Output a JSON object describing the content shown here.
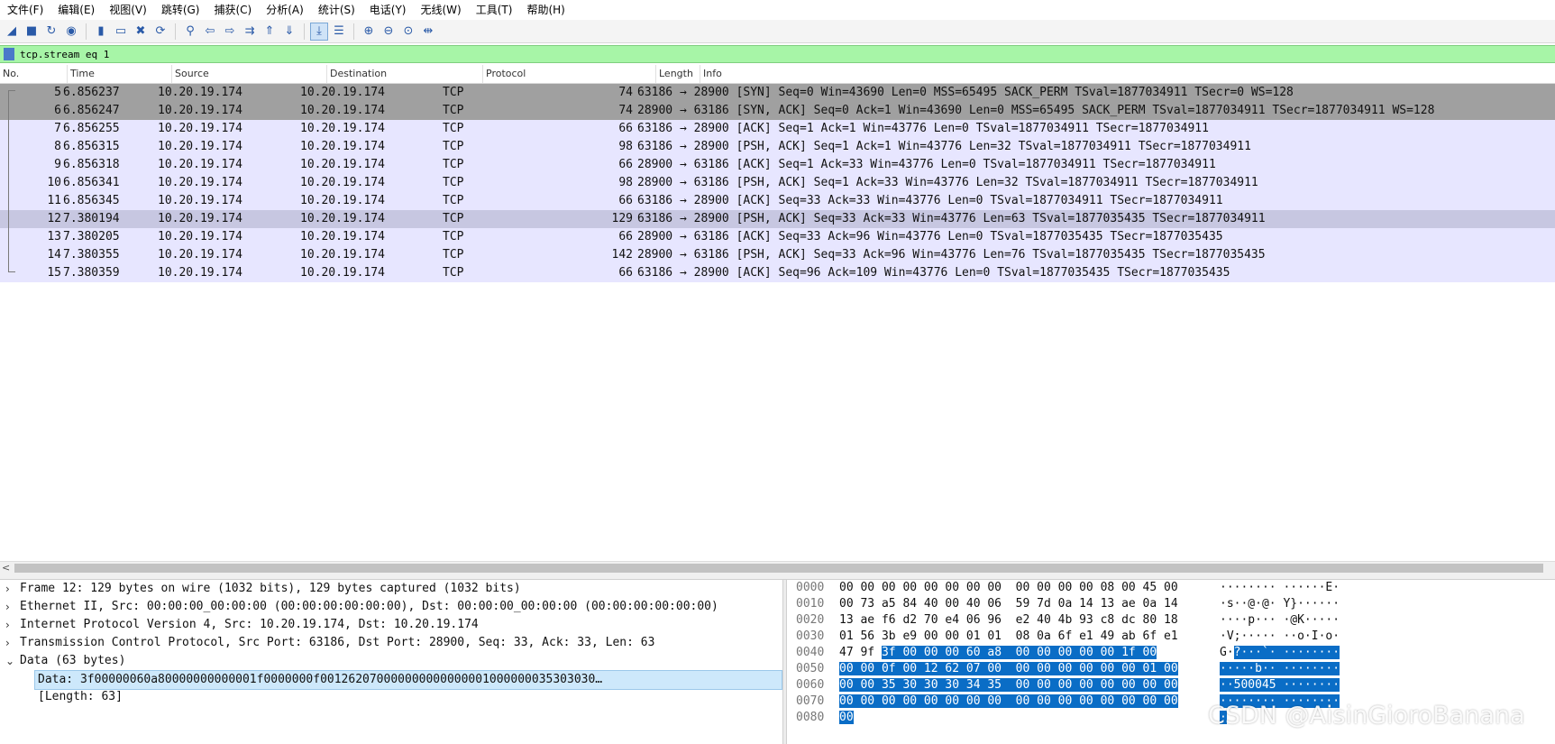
{
  "menu": [
    "文件(F)",
    "编辑(E)",
    "视图(V)",
    "跳转(G)",
    "捕获(C)",
    "分析(A)",
    "统计(S)",
    "电话(Y)",
    "无线(W)",
    "工具(T)",
    "帮助(H)"
  ],
  "toolbar": {
    "icons": [
      "shark-fin-start-icon",
      "stop-square-icon",
      "restart-fin-icon",
      "capture-options-icon",
      "open-folder-icon",
      "save-file-icon",
      "close-file-icon",
      "reload-icon",
      "find-packet-icon",
      "go-back-icon",
      "go-forward-icon",
      "go-to-packet-icon",
      "go-first-icon",
      "go-last-icon",
      "autoscroll-icon",
      "colorize-icon",
      "zoom-in-icon",
      "zoom-out-icon",
      "zoom-normal-icon",
      "resize-columns-icon"
    ],
    "glyphs": [
      "◢",
      "■",
      "↻",
      "◉",
      "▮",
      "▭",
      "✖",
      "⟳",
      "⚲",
      "⇦",
      "⇨",
      "⇉",
      "⇑",
      "⇓",
      "⤓",
      "☰",
      "⊕",
      "⊖",
      "⊙",
      "⇹"
    ]
  },
  "filter": {
    "text": "tcp.stream eq 1"
  },
  "packet_list": {
    "headers": [
      "No.",
      "Time",
      "Source",
      "Destination",
      "Protocol",
      "Length",
      "Info"
    ],
    "rows": [
      {
        "no": "5",
        "time": "6.856237",
        "src": "10.20.19.174",
        "dst": "10.20.19.174",
        "proto": "TCP",
        "len": "74",
        "info": "63186 → 28900 [SYN] Seq=0 Win=43690 Len=0 MSS=65495 SACK_PERM TSval=1877034911 TSecr=0 WS=128",
        "style": "syn"
      },
      {
        "no": "6",
        "time": "6.856247",
        "src": "10.20.19.174",
        "dst": "10.20.19.174",
        "proto": "TCP",
        "len": "74",
        "info": "28900 → 63186 [SYN, ACK] Seq=0 Ack=1 Win=43690 Len=0 MSS=65495 SACK_PERM TSval=1877034911 TSecr=1877034911 WS=128",
        "style": "syn"
      },
      {
        "no": "7",
        "time": "6.856255",
        "src": "10.20.19.174",
        "dst": "10.20.19.174",
        "proto": "TCP",
        "len": "66",
        "info": "63186 → 28900 [ACK] Seq=1 Ack=1 Win=43776 Len=0 TSval=1877034911 TSecr=1877034911",
        "style": "norm"
      },
      {
        "no": "8",
        "time": "6.856315",
        "src": "10.20.19.174",
        "dst": "10.20.19.174",
        "proto": "TCP",
        "len": "98",
        "info": "63186 → 28900 [PSH, ACK] Seq=1 Ack=1 Win=43776 Len=32 TSval=1877034911 TSecr=1877034911",
        "style": "norm"
      },
      {
        "no": "9",
        "time": "6.856318",
        "src": "10.20.19.174",
        "dst": "10.20.19.174",
        "proto": "TCP",
        "len": "66",
        "info": "28900 → 63186 [ACK] Seq=1 Ack=33 Win=43776 Len=0 TSval=1877034911 TSecr=1877034911",
        "style": "norm"
      },
      {
        "no": "10",
        "time": "6.856341",
        "src": "10.20.19.174",
        "dst": "10.20.19.174",
        "proto": "TCP",
        "len": "98",
        "info": "28900 → 63186 [PSH, ACK] Seq=1 Ack=33 Win=43776 Len=32 TSval=1877034911 TSecr=1877034911",
        "style": "norm"
      },
      {
        "no": "11",
        "time": "6.856345",
        "src": "10.20.19.174",
        "dst": "10.20.19.174",
        "proto": "TCP",
        "len": "66",
        "info": "63186 → 28900 [ACK] Seq=33 Ack=33 Win=43776 Len=0 TSval=1877034911 TSecr=1877034911",
        "style": "norm"
      },
      {
        "no": "12",
        "time": "7.380194",
        "src": "10.20.19.174",
        "dst": "10.20.19.174",
        "proto": "TCP",
        "len": "129",
        "info": "63186 → 28900 [PSH, ACK] Seq=33 Ack=33 Win=43776 Len=63 TSval=1877035435 TSecr=1877034911",
        "style": "sel"
      },
      {
        "no": "13",
        "time": "7.380205",
        "src": "10.20.19.174",
        "dst": "10.20.19.174",
        "proto": "TCP",
        "len": "66",
        "info": "28900 → 63186 [ACK] Seq=33 Ack=96 Win=43776 Len=0 TSval=1877035435 TSecr=1877035435",
        "style": "norm"
      },
      {
        "no": "14",
        "time": "7.380355",
        "src": "10.20.19.174",
        "dst": "10.20.19.174",
        "proto": "TCP",
        "len": "142",
        "info": "28900 → 63186 [PSH, ACK] Seq=33 Ack=96 Win=43776 Len=76 TSval=1877035435 TSecr=1877035435",
        "style": "norm"
      },
      {
        "no": "15",
        "time": "7.380359",
        "src": "10.20.19.174",
        "dst": "10.20.19.174",
        "proto": "TCP",
        "len": "66",
        "info": "63186 → 28900 [ACK] Seq=96 Ack=109 Win=43776 Len=0 TSval=1877035435 TSecr=1877035435",
        "style": "norm"
      }
    ]
  },
  "details": [
    {
      "arrow": "›",
      "text": "Frame 12: 129 bytes on wire (1032 bits), 129 bytes captured (1032 bits)",
      "kind": "top"
    },
    {
      "arrow": "›",
      "text": "Ethernet II, Src: 00:00:00_00:00:00 (00:00:00:00:00:00), Dst: 00:00:00_00:00:00 (00:00:00:00:00:00)",
      "kind": "top"
    },
    {
      "arrow": "›",
      "text": "Internet Protocol Version 4, Src: 10.20.19.174, Dst: 10.20.19.174",
      "kind": "top"
    },
    {
      "arrow": "›",
      "text": "Transmission Control Protocol, Src Port: 63186, Dst Port: 28900, Seq: 33, Ack: 33, Len: 63",
      "kind": "top"
    },
    {
      "arrow": "⌄",
      "text": "Data (63 bytes)",
      "kind": "top"
    },
    {
      "arrow": "",
      "text": "Data: 3f00000060a80000000000001f0000000f001262070000000000000001000000035303030…",
      "kind": "hl"
    },
    {
      "arrow": "",
      "text": "[Length: 63]",
      "kind": "sub"
    }
  ],
  "hex": [
    {
      "off": "0000",
      "pre": "00 00 00 00 00 00 00 00  00 00 00 00 08 00 45 00",
      "sel": "",
      "apre": "········ ······E·",
      "asel": ""
    },
    {
      "off": "0010",
      "pre": "00 73 a5 84 40 00 40 06  59 7d 0a 14 13 ae 0a 14",
      "sel": "",
      "apre": "·s··@·@· Y}······",
      "asel": ""
    },
    {
      "off": "0020",
      "pre": "13 ae f6 d2 70 e4 06 96  e2 40 4b 93 c8 dc 80 18",
      "sel": "",
      "apre": "····p··· ·@K·····",
      "asel": ""
    },
    {
      "off": "0030",
      "pre": "01 56 3b e9 00 00 01 01  08 0a 6f e1 49 ab 6f e1",
      "sel": "",
      "apre": "·V;····· ··o·I·o·",
      "asel": ""
    },
    {
      "off": "0040",
      "pre": "47 9f ",
      "sel": "3f 00 00 00 60 a8  00 00 00 00 00 1f 00",
      "apre": "G·",
      "asel": "?···`· ········"
    },
    {
      "off": "0050",
      "pre": "",
      "sel": "00 00 0f 00 12 62 07 00  00 00 00 00 00 00 01 00",
      "apre": "",
      "asel": "·····b·· ········"
    },
    {
      "off": "0060",
      "pre": "",
      "sel": "00 00 35 30 30 30 34 35  00 00 00 00 00 00 00 00",
      "apre": "",
      "asel": "··500045 ········"
    },
    {
      "off": "0070",
      "pre": "",
      "sel": "00 00 00 00 00 00 00 00  00 00 00 00 00 00 00 00",
      "apre": "",
      "asel": "········ ········"
    },
    {
      "off": "0080",
      "pre": "",
      "sel": "00",
      "apre": "",
      "asel": "·"
    }
  ],
  "watermark": "CSDN @AisinGioroBanana",
  "colors": {
    "filter_bg": "#a7f5a7",
    "row_syn": "#a0a0a0",
    "row_norm": "#e7e6ff",
    "row_selected": "#c7c7e1",
    "hex_selection": "#0a6dc6"
  }
}
